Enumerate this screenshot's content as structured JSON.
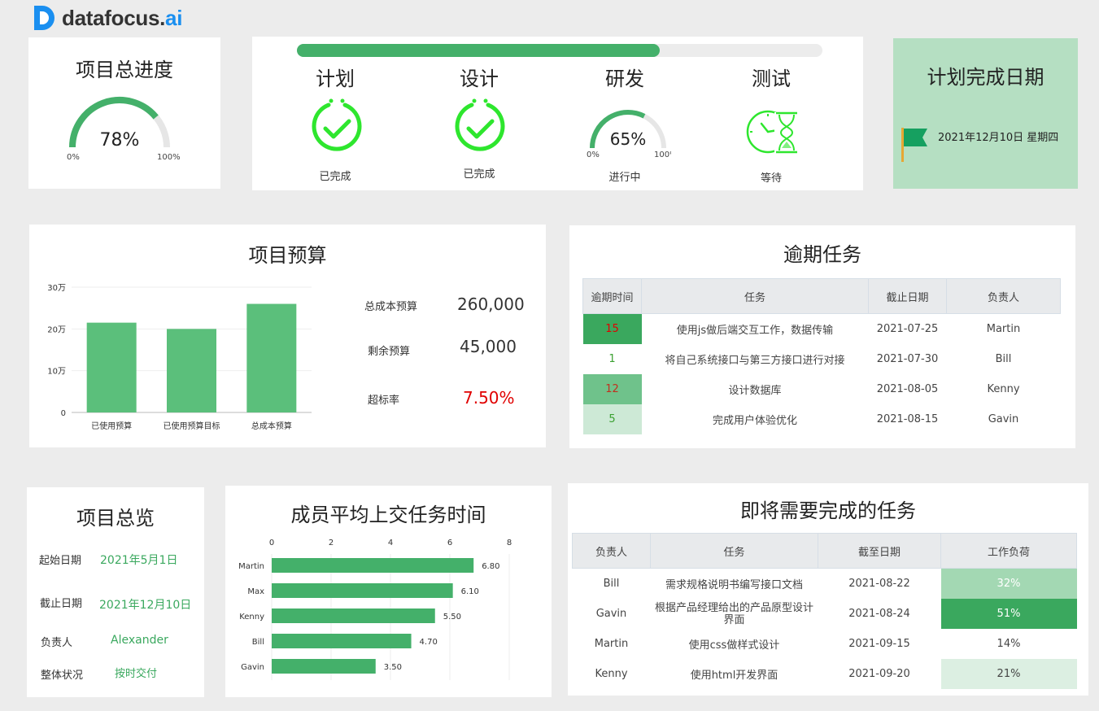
{
  "brand": {
    "name_main": "datafocus.",
    "name_accent": "ai"
  },
  "overall": {
    "title": "项目总进度",
    "percent_text": "78%",
    "value": 78,
    "min_label": "0%",
    "max_label": "100%"
  },
  "stages": [
    {
      "name": "计划",
      "status": "已完成",
      "icon": "check-circle-icon"
    },
    {
      "name": "设计",
      "status": "已完成",
      "icon": "check-circle-icon"
    },
    {
      "name": "研发",
      "status": "进行中",
      "icon": "gauge",
      "percent_text": "65%",
      "value": 65,
      "min_label": "0%",
      "max_label": "100%"
    },
    {
      "name": "测试",
      "status": "等待",
      "icon": "hourglass-clock-icon"
    }
  ],
  "stage_progress": 0.69,
  "deadline": {
    "title": "计划完成日期",
    "date": "2021年12月10日 星期四"
  },
  "budget": {
    "title": "项目预算",
    "items": [
      {
        "label": "总成本预算",
        "value": "260,000"
      },
      {
        "label": "剩余预算",
        "value": "45,000"
      },
      {
        "label": "超标率",
        "value": "7.50%"
      }
    ]
  },
  "overdue": {
    "title": "逾期任务",
    "headers": [
      "逾期时间",
      "任务",
      "截止日期",
      "负责人"
    ],
    "rows": [
      {
        "days": "15",
        "task": "使用js做后端交互工作，数据传输",
        "date": "2021-07-25",
        "owner": "Martin"
      },
      {
        "days": "1",
        "task": "将自己系统接口与第三方接口进行对接",
        "date": "2021-07-30",
        "owner": "Bill"
      },
      {
        "days": "12",
        "task": "设计数据库",
        "date": "2021-08-05",
        "owner": "Kenny"
      },
      {
        "days": "5",
        "task": "完成用户体验优化",
        "date": "2021-08-15",
        "owner": "Gavin"
      }
    ]
  },
  "overview": {
    "title": "项目总览",
    "items": [
      {
        "label": "起始日期",
        "value": "2021年5月1日"
      },
      {
        "label": "截止日期",
        "value": "2021年12月10日"
      },
      {
        "label": "负责人",
        "value": "Alexander"
      },
      {
        "label": "整体状况",
        "value": "按时交付"
      }
    ]
  },
  "members": {
    "title": "成员平均上交任务时间"
  },
  "upcoming": {
    "title": "即将需要完成的任务",
    "headers": [
      "负责人",
      "任务",
      "截至日期",
      "工作负荷"
    ],
    "rows": [
      {
        "owner": "Bill",
        "task": "需求规格说明书编写接口文档",
        "date": "2021-08-22",
        "load": "32%"
      },
      {
        "owner": "Gavin",
        "task": "根据产品经理给出的产品原型设计界面",
        "date": "2021-08-24",
        "load": "51%"
      },
      {
        "owner": "Martin",
        "task": "使用css做样式设计",
        "date": "2021-09-15",
        "load": "14%"
      },
      {
        "owner": "Kenny",
        "task": "使用html开发界面",
        "date": "2021-09-20",
        "load": "21%"
      }
    ]
  },
  "colors": {
    "green": "#44b06a",
    "light_green": "#b5dfc2",
    "red": "#e00000",
    "check_green": "#2ee62e"
  },
  "chart_data": [
    {
      "type": "bar",
      "title": "",
      "categories": [
        "已使用预算",
        "已使用预算目标",
        "总成本预算"
      ],
      "values": [
        215000,
        200000,
        260000
      ],
      "ylim": [
        0,
        300000
      ],
      "yticks": [
        "0",
        "10万",
        "20万",
        "30万"
      ],
      "grid": true
    },
    {
      "type": "bar",
      "orientation": "horizontal",
      "title": "",
      "categories": [
        "Martin",
        "Max",
        "Kenny",
        "Bill",
        "Gavin"
      ],
      "values": [
        6.8,
        6.1,
        5.5,
        4.7,
        3.5
      ],
      "value_labels": [
        "6.80",
        "6.10",
        "5.50",
        "4.70",
        "3.50"
      ],
      "xlim": [
        0,
        8
      ],
      "xticks": [
        "0",
        "2",
        "4",
        "6",
        "8"
      ],
      "grid": true
    }
  ]
}
